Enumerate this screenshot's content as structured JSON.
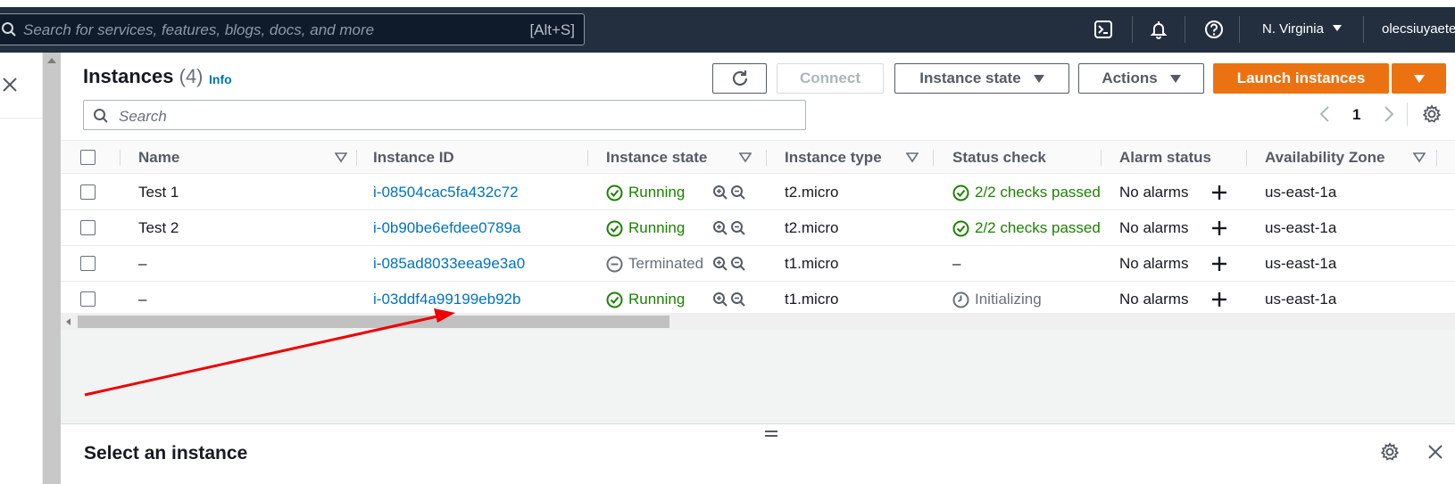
{
  "topnav": {
    "search_placeholder": "Search for services, features, blogs, docs, and more",
    "search_shortcut": "[Alt+S]",
    "region": "N. Virginia",
    "user": "olecsiuyaete"
  },
  "header": {
    "title": "Instances",
    "count": "(4)",
    "info": "Info",
    "buttons": {
      "connect": "Connect",
      "instance_state": "Instance state",
      "actions": "Actions",
      "launch": "Launch instances"
    },
    "search_placeholder": "Search",
    "page": "1"
  },
  "table": {
    "columns": [
      "Name",
      "Instance ID",
      "Instance state",
      "Instance type",
      "Status check",
      "Alarm status",
      "Availability Zone"
    ],
    "rows": [
      {
        "name": "Test 1",
        "id": "i-08504cac5fa432c72",
        "state": "Running",
        "state_kind": "running",
        "type": "t2.micro",
        "status": "2/2 checks passed",
        "status_kind": "passed",
        "alarm": "No alarms",
        "az": "us-east-1a"
      },
      {
        "name": "Test 2",
        "id": "i-0b90be6efdee0789a",
        "state": "Running",
        "state_kind": "running",
        "type": "t2.micro",
        "status": "2/2 checks passed",
        "status_kind": "passed",
        "alarm": "No alarms",
        "az": "us-east-1a"
      },
      {
        "name": "–",
        "id": "i-085ad8033eea9e3a0",
        "state": "Terminated",
        "state_kind": "terminated",
        "type": "t1.micro",
        "status": "–",
        "status_kind": "none",
        "alarm": "No alarms",
        "az": "us-east-1a"
      },
      {
        "name": "–",
        "id": "i-03ddf4a99199eb92b",
        "state": "Running",
        "state_kind": "running",
        "type": "t1.micro",
        "status": "Initializing",
        "status_kind": "initializing",
        "alarm": "No alarms",
        "az": "us-east-1a"
      }
    ]
  },
  "bottom_panel": {
    "title": "Select an instance"
  },
  "colors": {
    "nav_bg": "#232f3e",
    "primary": "#ec7211",
    "link": "#0073bb",
    "success": "#1d8102",
    "annotation_arrow": "#ee0000"
  }
}
